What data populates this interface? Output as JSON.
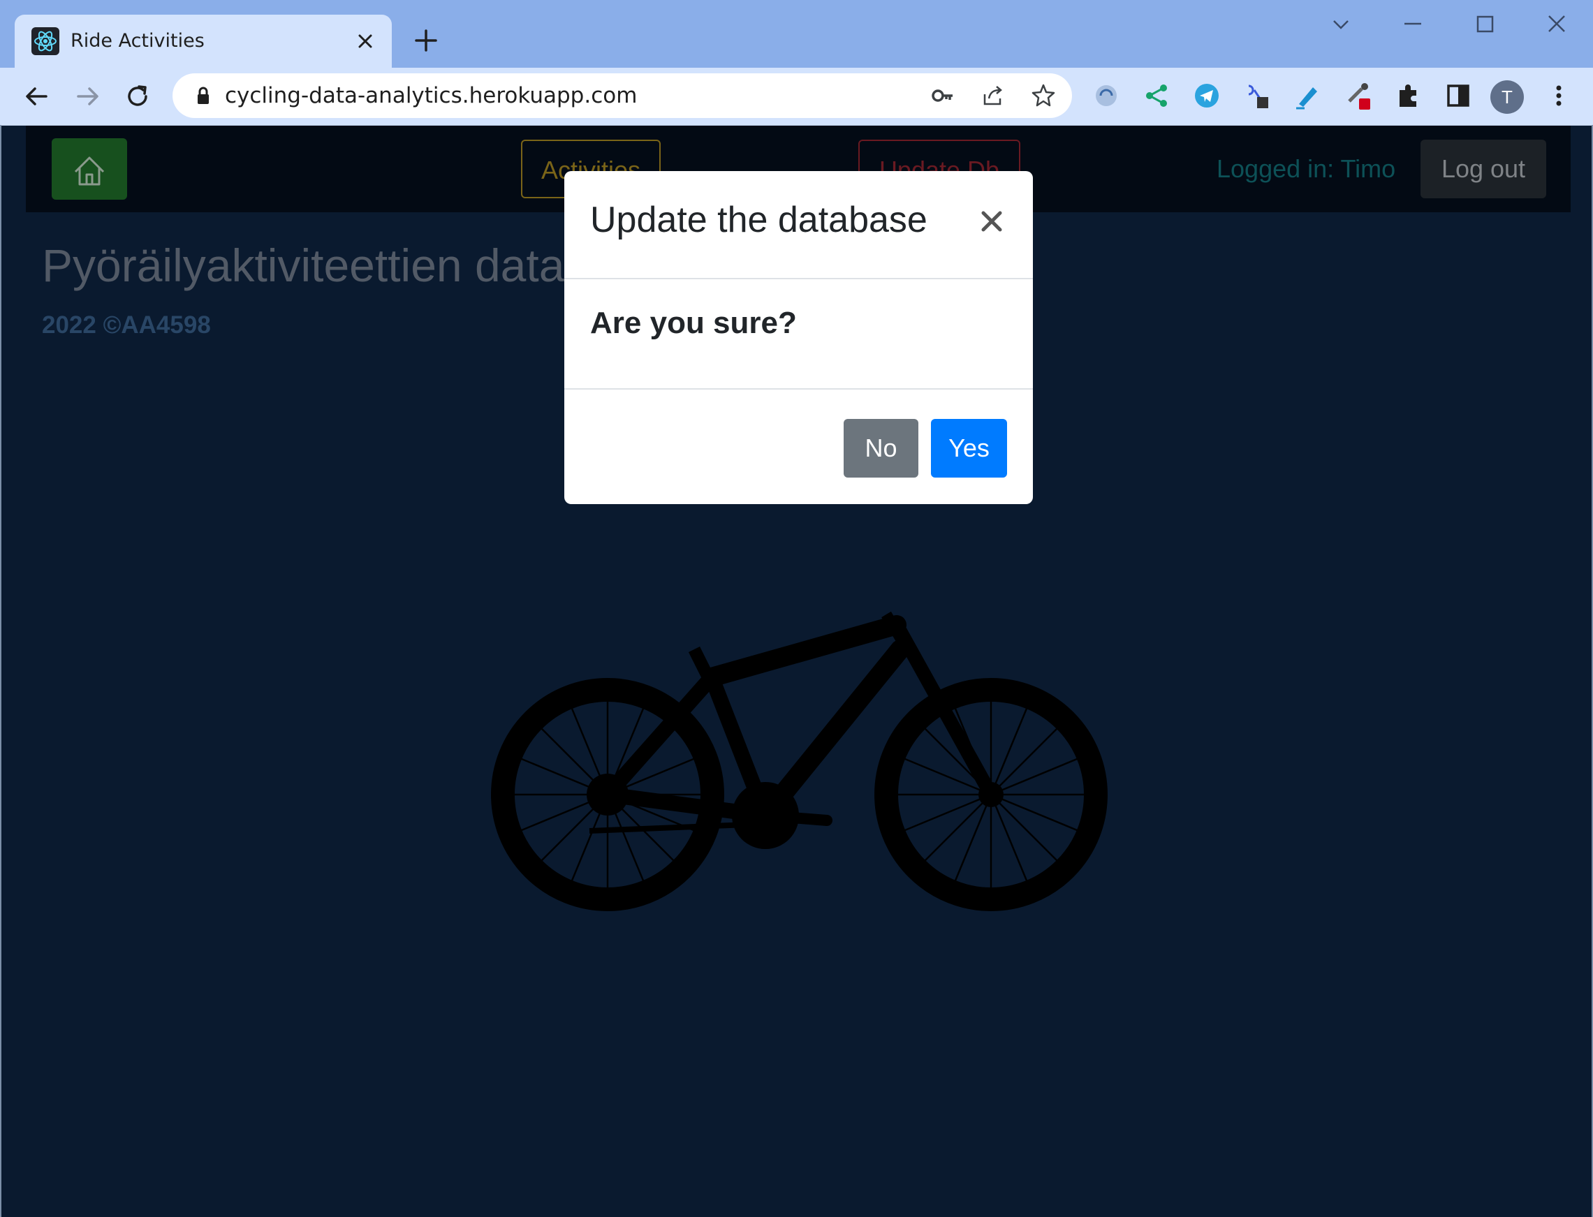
{
  "browser": {
    "tab": {
      "title": "Ride Activities",
      "favicon": "react-icon"
    },
    "url": "cycling-data-analytics.herokuapp.com",
    "profile_initial": "T",
    "extensions": [
      "extension-refresh-icon",
      "share-icon",
      "telegram-icon",
      "link-icon",
      "highlighter-icon",
      "color-picker-icon",
      "puzzle-icon",
      "sidepanel-icon"
    ]
  },
  "navbar": {
    "home_icon": "house-icon",
    "activities_label": "Activities",
    "update_db_label": "Update Db",
    "logged_in_text": "Logged in: Timo",
    "logout_label": "Log out"
  },
  "page": {
    "heading": "Pyöräilyaktiviteettien data",
    "copyright": "2022 ©AA4598"
  },
  "modal": {
    "title": "Update the database",
    "body": "Are you sure?",
    "no_label": "No",
    "yes_label": "Yes"
  },
  "colors": {
    "page_bg": "#0a1a2f",
    "primary": "#007bff",
    "secondary": "#6c757d",
    "chrome_frame": "#8aaee9"
  }
}
